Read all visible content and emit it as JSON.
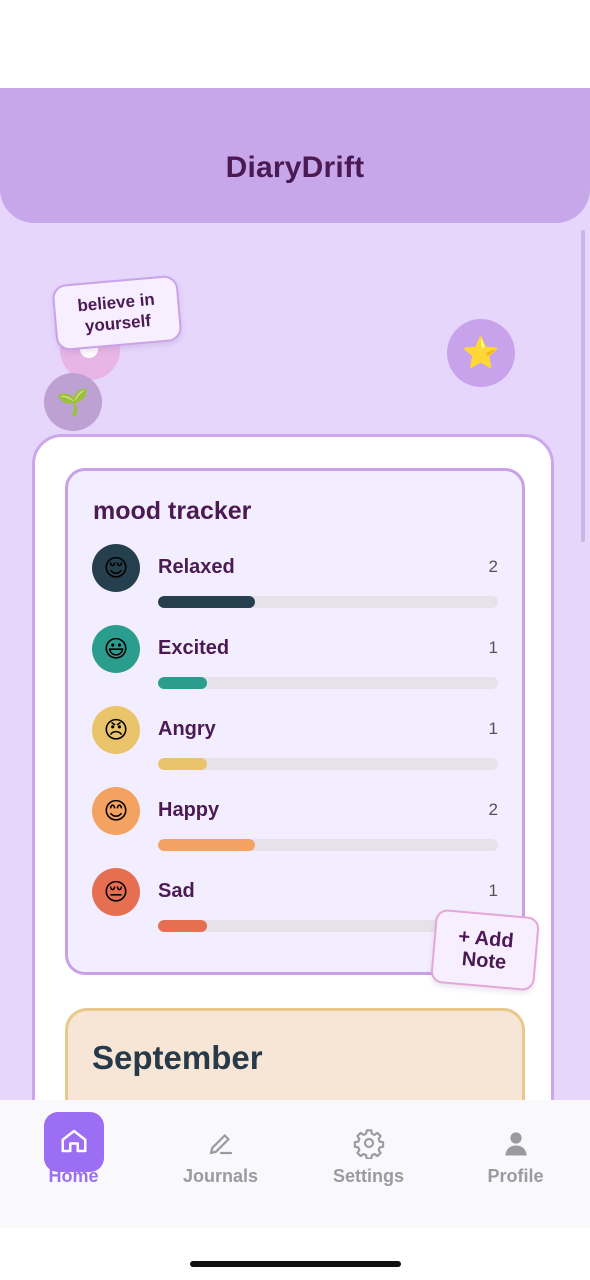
{
  "app": {
    "title": "DiaryDrift"
  },
  "sticker_text": "believe in yourself",
  "decor": {
    "star_icon": "⭐",
    "sprout_icon": "🌱"
  },
  "mood_tracker": {
    "title": "mood tracker",
    "max_count": 7,
    "moods": [
      {
        "label": "Relaxed",
        "count": "2",
        "emoji": "😌",
        "color": "#263f4f"
      },
      {
        "label": "Excited",
        "count": "1",
        "emoji": "😃",
        "color": "#2a9d8f"
      },
      {
        "label": "Angry",
        "count": "1",
        "emoji": "😠",
        "color": "#e9c46a"
      },
      {
        "label": "Happy",
        "count": "2",
        "emoji": "😊",
        "color": "#f4a261"
      },
      {
        "label": "Sad",
        "count": "1",
        "emoji": "😔",
        "color": "#e76f51"
      }
    ]
  },
  "add_note_label": "+ Add Note",
  "calendar": {
    "month": "September"
  },
  "tabs": [
    {
      "label": "Home",
      "icon": "home-icon",
      "active": true
    },
    {
      "label": "Journals",
      "icon": "pencil-icon",
      "active": false
    },
    {
      "label": "Settings",
      "icon": "gear-icon",
      "active": false
    },
    {
      "label": "Profile",
      "icon": "person-icon",
      "active": false
    }
  ],
  "colors": {
    "accent": "#9b6ef3",
    "header_bg": "#c7a6ea",
    "app_bg": "#e6d6fc",
    "title_text": "#4b1a52"
  }
}
